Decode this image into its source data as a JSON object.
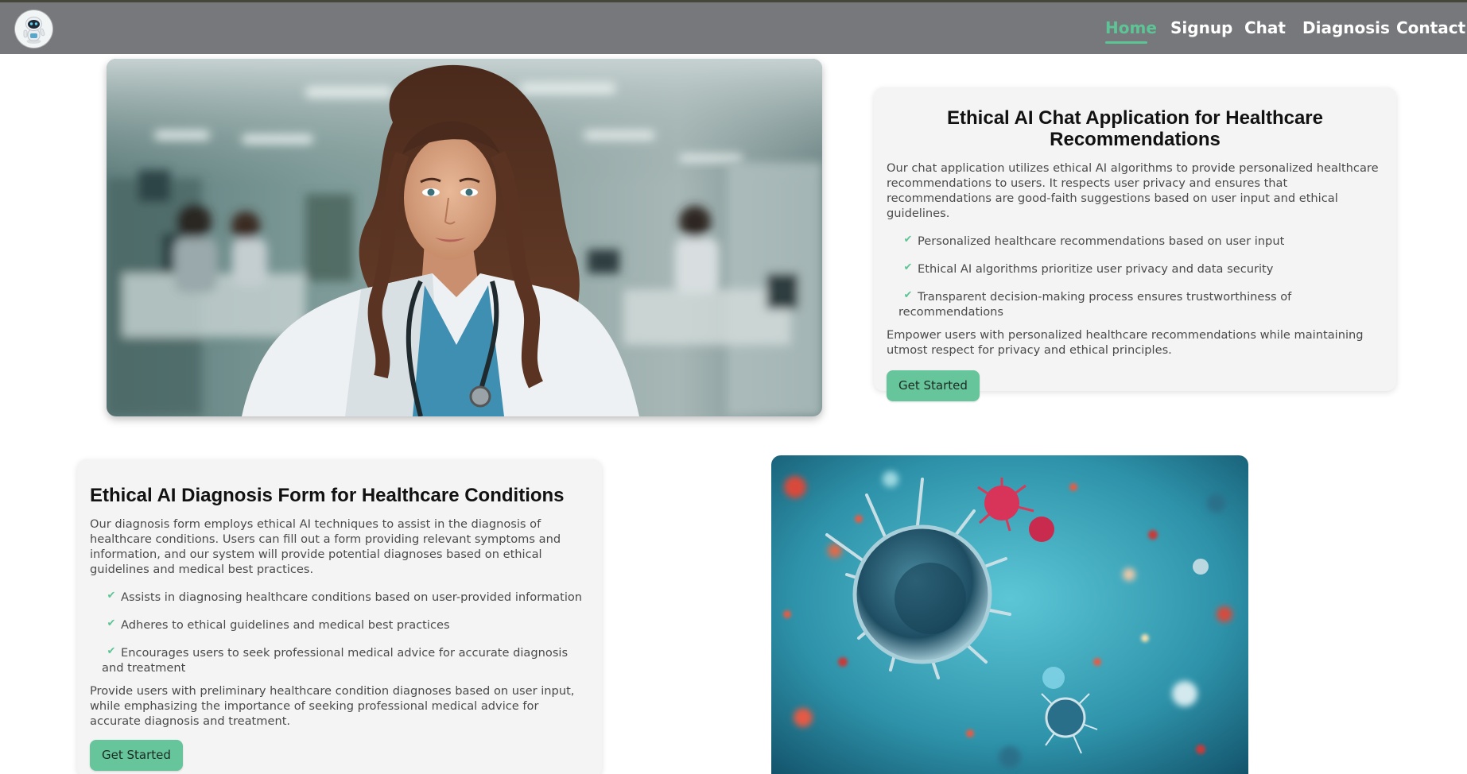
{
  "nav": {
    "links": [
      "Home",
      "Signup",
      "Chat",
      "Diagnosis",
      "Contact"
    ],
    "active": "Home"
  },
  "chat_section": {
    "title": "Ethical AI Chat Application for Healthcare Recommendations",
    "intro": "Our chat application utilizes ethical AI algorithms to provide personalized healthcare recommendations to users. It respects user privacy and ensures that recommendations are good-faith suggestions based on user input and ethical guidelines.",
    "features": [
      "Personalized healthcare recommendations based on user input",
      "Ethical AI algorithms prioritize user privacy and data security",
      "Transparent decision-making process ensures trustworthiness of recommendations"
    ],
    "outro": "Empower users with personalized healthcare recommendations while maintaining utmost respect for privacy and ethical principles.",
    "button": "Get Started"
  },
  "diagnosis_section": {
    "title": "Ethical AI Diagnosis Form for Healthcare Conditions",
    "intro": "Our diagnosis form employs ethical AI techniques to assist in the diagnosis of healthcare conditions. Users can fill out a form providing relevant symptoms and information, and our system will provide potential diagnoses based on ethical guidelines and medical best practices.",
    "features": [
      "Assists in diagnosing healthcare conditions based on user-provided information",
      "Adheres to ethical guidelines and medical best practices",
      "Encourages users to seek professional medical advice for accurate diagnosis and treatment"
    ],
    "outro": "Provide users with preliminary healthcare condition diagnoses based on user input, while emphasizing the importance of seeking professional medical advice for accurate diagnosis and treatment.",
    "button": "Get Started"
  },
  "icons": {
    "logo": "robot-logo-icon",
    "feature_bullet": "check-icon"
  },
  "colors": {
    "nav_background": "#77787c",
    "accent": "#5dc495",
    "button": "#66c59a",
    "card_background": "#f4f4f4"
  }
}
